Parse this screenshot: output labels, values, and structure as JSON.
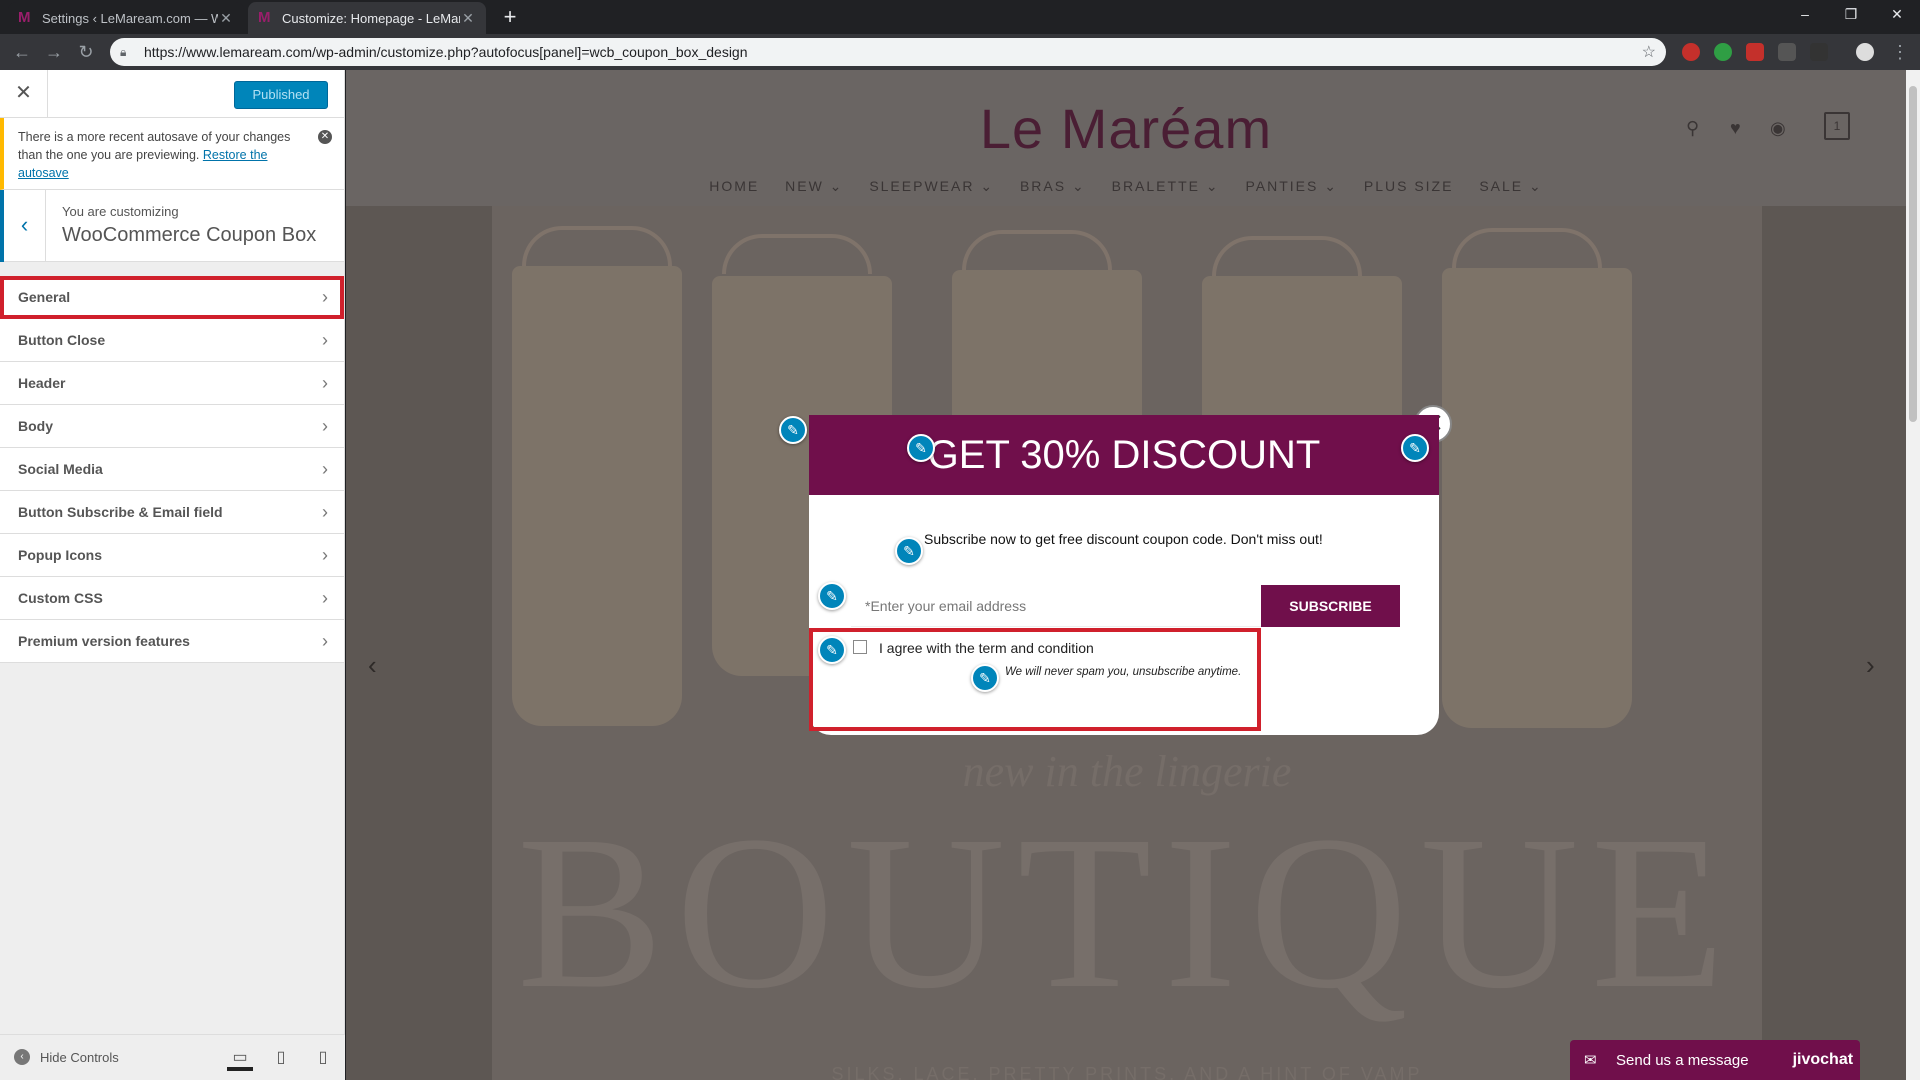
{
  "browser": {
    "tabs": [
      {
        "title": "Settings ‹ LeMaream.com — Wo",
        "favicon": "M"
      },
      {
        "title": "Customize: Homepage - LeMare",
        "favicon": "M"
      }
    ],
    "url": "https://www.lemaream.com/wp-admin/customize.php?autofocus[panel]=wcb_coupon_box_design"
  },
  "sidebar": {
    "publish_label": "Published",
    "autosave_notice": "There is a more recent autosave of your changes than the one you are previewing.",
    "restore_link": "Restore the autosave",
    "customizing_label": "You are customizing",
    "section_title": "WooCommerce Coupon Box",
    "menu": [
      "General",
      "Button Close",
      "Header",
      "Body",
      "Social Media",
      "Button Subscribe & Email field",
      "Popup Icons",
      "Custom CSS",
      "Premium version features"
    ],
    "hide_controls": "Hide Controls"
  },
  "site": {
    "logo": "Le Maréam",
    "nav": [
      "HOME",
      "NEW ⌄",
      "SLEEPWEAR ⌄",
      "BRAS ⌄",
      "BRALETTE ⌄",
      "PANTIES ⌄",
      "PLUS SIZE",
      "SALE ⌄"
    ],
    "cart_count": "1",
    "hero_script": "new in the lingerie",
    "hero_big": "BOUTIQUE",
    "hero_tagline": "SILKS, LACE, PRETTY PRINTS, AND A HINT OF VAMP"
  },
  "popup": {
    "title": "GET 30% DISCOUNT",
    "message": "Subscribe now to get free discount coupon code. Don't miss out!",
    "email_placeholder": "*Enter your email address",
    "subscribe_label": "SUBSCRIBE",
    "agree_label": "I agree with the term and condition",
    "no_spam": "We will never spam you, unsubscribe anytime."
  },
  "chat": {
    "label": "Send us a message",
    "brand": "jivochat"
  },
  "colors": {
    "brand_purple": "#700f4b",
    "wp_blue": "#0085ba",
    "highlight_red": "#d0202c"
  }
}
